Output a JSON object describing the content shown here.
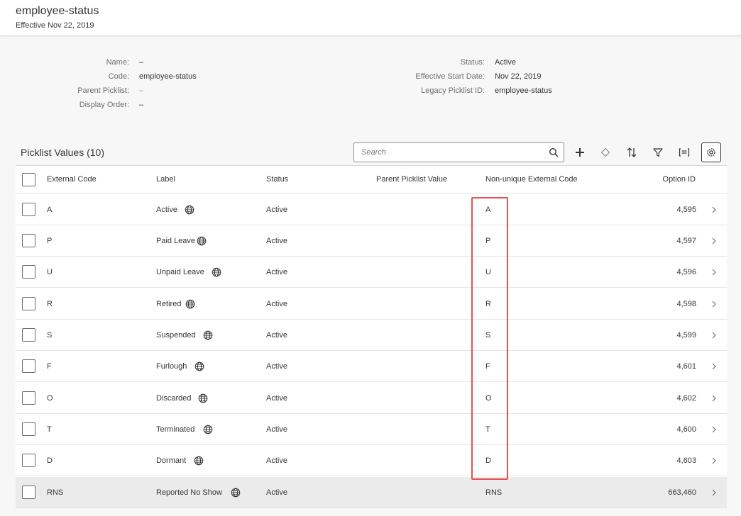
{
  "header": {
    "title": "employee-status",
    "subtitle": "Effective Nov 22, 2019"
  },
  "details": {
    "left": [
      {
        "label": "Name:",
        "value": "–"
      },
      {
        "label": "Code:",
        "value": "employee-status"
      },
      {
        "label": "Parent Picklist:",
        "value": "–"
      },
      {
        "label": "Display Order:",
        "value": "–"
      }
    ],
    "right": [
      {
        "label": "Status:",
        "value": "Active"
      },
      {
        "label": "Effective Start Date:",
        "value": "Nov 22, 2019"
      },
      {
        "label": "Legacy Picklist ID:",
        "value": "employee-status"
      }
    ]
  },
  "list": {
    "title": "Picklist Values (10)",
    "search_placeholder": "Search"
  },
  "toolbar_icons": [
    "add-icon",
    "diamond-icon",
    "sort-icon",
    "filter-icon",
    "group-icon",
    "settings-icon"
  ],
  "table": {
    "columns": [
      "External Code",
      "Label",
      "Status",
      "Parent Picklist Value",
      "Non-unique External Code",
      "Option ID"
    ],
    "rows": [
      {
        "code": "A",
        "label": "Active",
        "status": "Active",
        "parent": "",
        "nonunique": "A",
        "option_id": "4,595"
      },
      {
        "code": "P",
        "label": "Paid Leave",
        "status": "Active",
        "parent": "",
        "nonunique": "P",
        "option_id": "4,597"
      },
      {
        "code": "U",
        "label": "Unpaid Leave",
        "status": "Active",
        "parent": "",
        "nonunique": "U",
        "option_id": "4,596"
      },
      {
        "code": "R",
        "label": "Retired",
        "status": "Active",
        "parent": "",
        "nonunique": "R",
        "option_id": "4,598"
      },
      {
        "code": "S",
        "label": "Suspended",
        "status": "Active",
        "parent": "",
        "nonunique": "S",
        "option_id": "4,599"
      },
      {
        "code": "F",
        "label": "Furlough",
        "status": "Active",
        "parent": "",
        "nonunique": "F",
        "option_id": "4,601"
      },
      {
        "code": "O",
        "label": "Discarded",
        "status": "Active",
        "parent": "",
        "nonunique": "O",
        "option_id": "4,602"
      },
      {
        "code": "T",
        "label": "Terminated",
        "status": "Active",
        "parent": "",
        "nonunique": "T",
        "option_id": "4,600"
      },
      {
        "code": "D",
        "label": "Dormant",
        "status": "Active",
        "parent": "",
        "nonunique": "D",
        "option_id": "4,603"
      },
      {
        "code": "RNS",
        "label": "Reported No Show",
        "status": "Active",
        "parent": "",
        "nonunique": "RNS",
        "option_id": "663,460"
      }
    ]
  },
  "colors": {
    "highlight": "#e8504f",
    "text": "#32363a",
    "label": "#6a6d70",
    "selected_row": "#ebebeb"
  }
}
